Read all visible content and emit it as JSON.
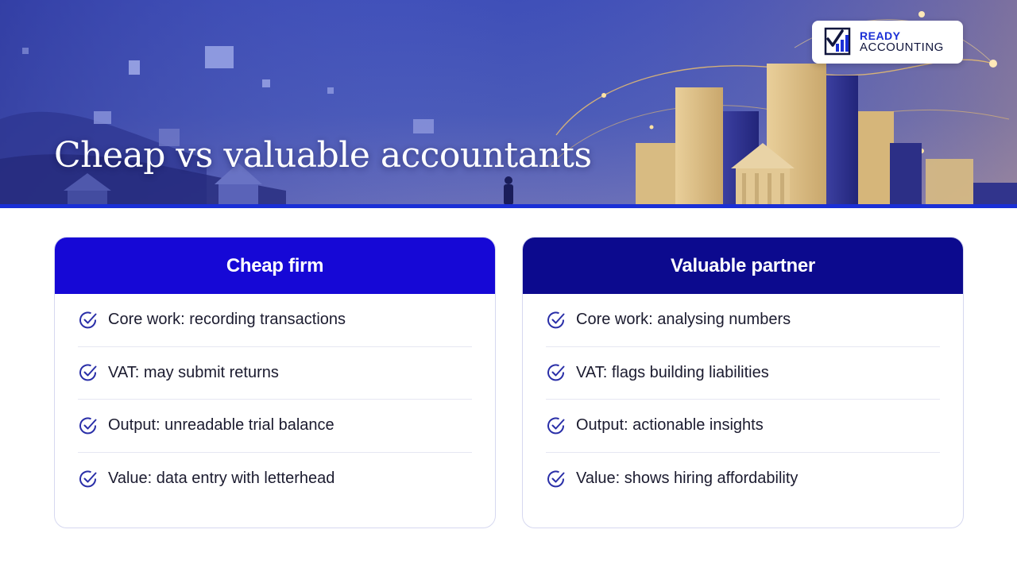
{
  "hero": {
    "title": "Cheap vs valuable accountants"
  },
  "logo": {
    "line1": "READY",
    "line2": "ACCOUNTING"
  },
  "colors": {
    "accent": "#1608d6",
    "accent_dark": "#0c0a8e",
    "hero_top": "#3d47b8",
    "hero_bottom": "#1d1f6a",
    "gold": "#f2c46a"
  },
  "cards": [
    {
      "title": "Cheap firm",
      "items": [
        "Core work: recording transactions",
        "VAT: may submit returns",
        "Output: unreadable trial balance",
        "Value: data entry with letterhead"
      ]
    },
    {
      "title": "Valuable partner",
      "items": [
        "Core work: analysing numbers",
        "VAT: flags building liabilities",
        "Output: actionable insights",
        "Value: shows hiring affordability"
      ]
    }
  ],
  "icons": {
    "item": "check-circle-icon",
    "logo": "chart-check-icon"
  }
}
